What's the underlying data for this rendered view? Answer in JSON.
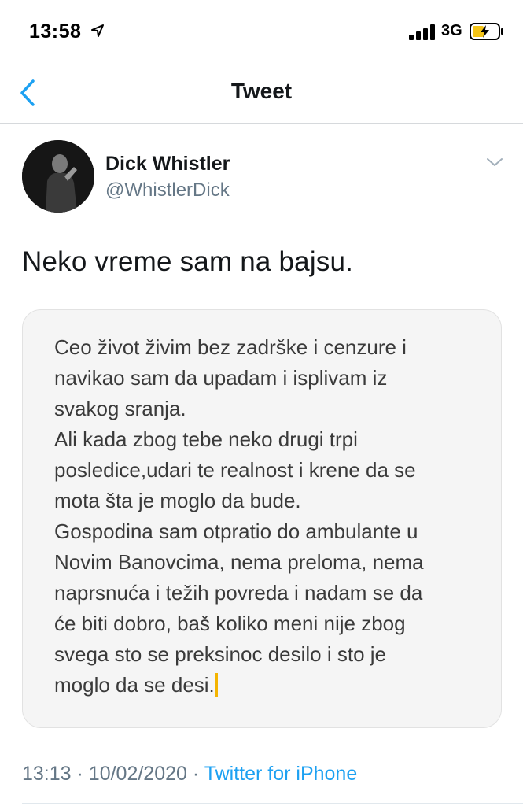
{
  "status_bar": {
    "time": "13:58",
    "network": "3G",
    "icons": [
      "location-arrow-icon",
      "signal-bars-icon",
      "battery-charging-icon"
    ]
  },
  "nav": {
    "title": "Tweet",
    "back_icon": "chevron-left-icon",
    "accent_color": "#1da1f2"
  },
  "tweet": {
    "author_name": "Dick Whistler",
    "author_handle": "@WhistlerDick",
    "text": "Neko vreme sam na bajsu.",
    "note_text": "Ceo život živim bez zadrške i cenzure i\nnavikao sam da upadam i isplivam iz\nsvakog sranja.\nAli kada zbog tebe neko drugi trpi\nposledice,udari te realnost i krene da se\nmota šta je moglo da bude.\nGospodina sam otpratio do ambulante u\nNovim Banovcima, nema preloma, nema\nnaprsnuća i težih povreda i nadam se da\nće biti dobro, baš koliko meni nije zbog\nsvega sto se preksinoc desilo i sto je\nmoglo da se desi.",
    "time": "13:13",
    "separator": "·",
    "date": "10/02/2020",
    "source": "Twitter for iPhone"
  }
}
